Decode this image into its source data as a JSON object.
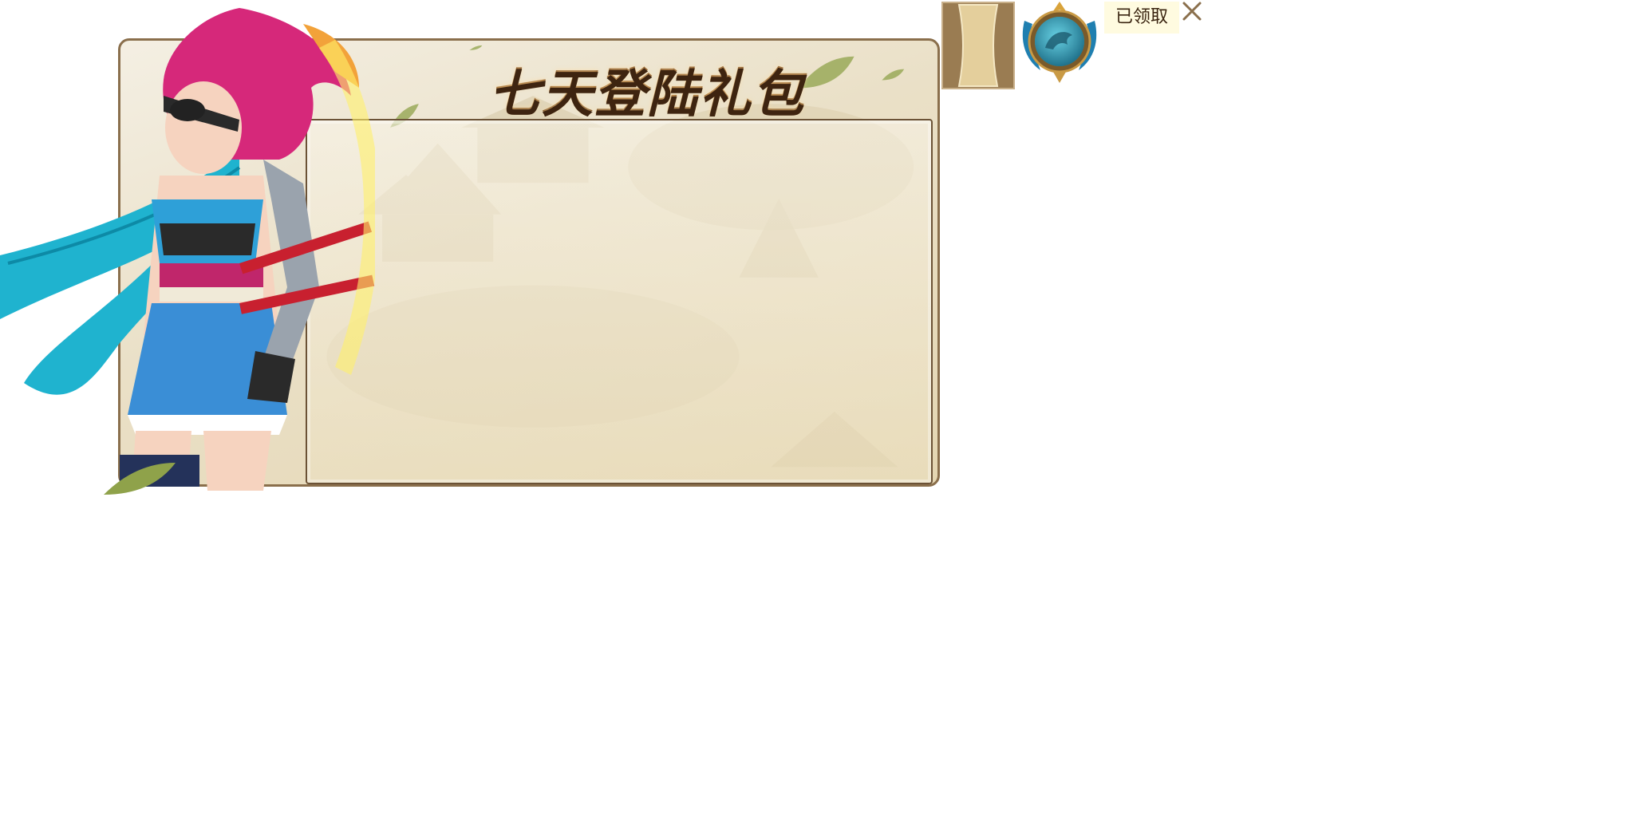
{
  "panel": {
    "title": "七天登陆礼包"
  },
  "reward": {
    "status_label": "已领取"
  },
  "icons": {
    "close": "close-icon",
    "card": "card-frame-icon",
    "emblem": "eagle-emblem-icon"
  },
  "colors": {
    "border": "#8a6f4c",
    "parchment": "#eae0c7",
    "title": "#7a4a1a",
    "badge_bg": "#fffbe0",
    "emblem_teal": "#2aa6c0"
  }
}
